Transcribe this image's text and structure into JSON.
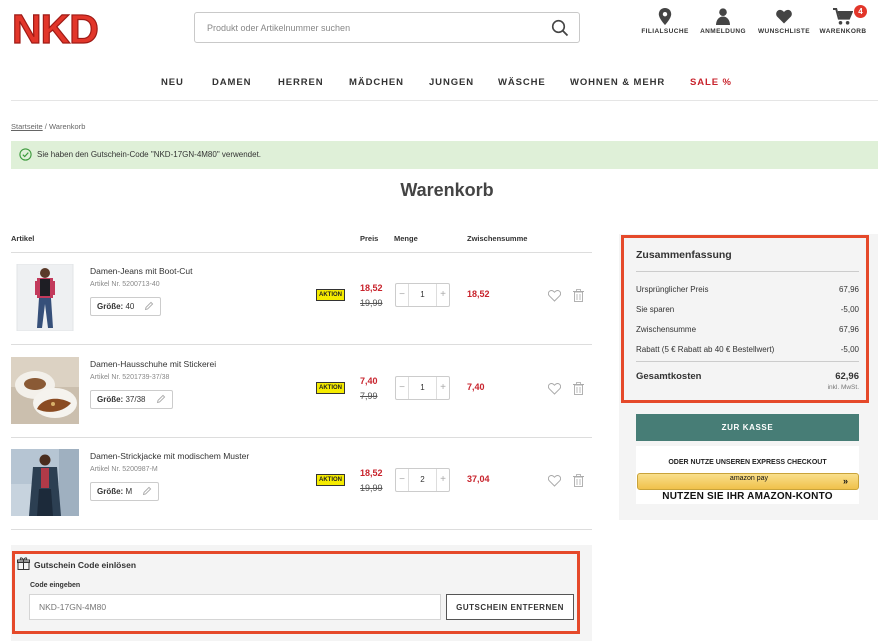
{
  "header": {
    "logo_text": "NKD",
    "search_placeholder": "Produkt oder Artikelnummer suchen",
    "nav": [
      {
        "label": "FILIALSUCHE",
        "icon": "location-pin-icon"
      },
      {
        "label": "ANMELDUNG",
        "icon": "user-icon"
      },
      {
        "label": "WUNSCHLISTE",
        "icon": "heart-icon"
      },
      {
        "label": "WARENKORB",
        "icon": "cart-icon",
        "badge": "4"
      }
    ]
  },
  "main_nav": [
    "NEU",
    "DAMEN",
    "HERREN",
    "MÄDCHEN",
    "JUNGEN",
    "WÄSCHE",
    "WOHNEN & MEHR",
    "SALE %"
  ],
  "breadcrumb": {
    "home": "Startseite",
    "separator": "/",
    "current": "Warenkorb"
  },
  "notice": "Sie haben den Gutschein-Code \"NKD-17GN-4M80\" verwendet.",
  "page_title": "Warenkorb",
  "table_headers": {
    "article": "Artikel",
    "price": "Preis",
    "quantity": "Menge",
    "subtotal": "Zwischensumme"
  },
  "items": [
    {
      "name": "Damen-Jeans mit Boot-Cut",
      "article_nr": "Artikel Nr. 5200713-40",
      "size_label": "Größe:",
      "size": "40",
      "badge": "AKTION",
      "price_new": "18,52",
      "price_old": "19,99",
      "qty": "1",
      "subtotal": "18,52"
    },
    {
      "name": "Damen-Hausschuhe mit Stickerei",
      "article_nr": "Artikel Nr. 5201739-37/38",
      "size_label": "Größe:",
      "size": "37/38",
      "badge": "AKTION",
      "price_new": "7,40",
      "price_old": "7,99",
      "qty": "1",
      "subtotal": "7,40"
    },
    {
      "name": "Damen-Strickjacke mit modischem Muster",
      "article_nr": "Artikel Nr. 5200987-M",
      "size_label": "Größe:",
      "size": "M",
      "badge": "AKTION",
      "price_new": "18,52",
      "price_old": "19,99",
      "qty": "2",
      "subtotal": "37,04"
    }
  ],
  "voucher": {
    "title": "Gutschein Code einlösen",
    "label": "Code eingeben",
    "value": "NKD-17GN-4M80",
    "button": "GUTSCHEIN ENTFERNEN"
  },
  "summary": {
    "title": "Zusammenfassung",
    "rows": [
      {
        "label": "Ursprünglicher Preis",
        "value": "67,96"
      },
      {
        "label": "Sie sparen",
        "value": "-5,00"
      },
      {
        "label": "Zwischensumme",
        "value": "67,96"
      },
      {
        "label": "Rabatt (5 € Rabatt ab 40 € Bestellwert)",
        "value": "-5,00"
      }
    ],
    "total_label": "Gesamtkosten",
    "total_value": "62,96",
    "vat_note": "inkl. MwSt."
  },
  "checkout": {
    "button": "ZUR KASSE",
    "express_label": "ODER NUTZE UNSEREN EXPRESS CHECKOUT",
    "amazon_label": "amazon pay",
    "amazon_arrow": "»",
    "amazon_cta": "NUTZEN SIE IHR AMAZON-KONTO"
  },
  "colors": {
    "brand_red": "#e2362a",
    "price_red": "#c8232c",
    "checkout_green": "#477d76",
    "highlight_border": "#e5492a",
    "notice_bg": "#dff0d8",
    "aktion_yellow": "#f5eb00"
  }
}
